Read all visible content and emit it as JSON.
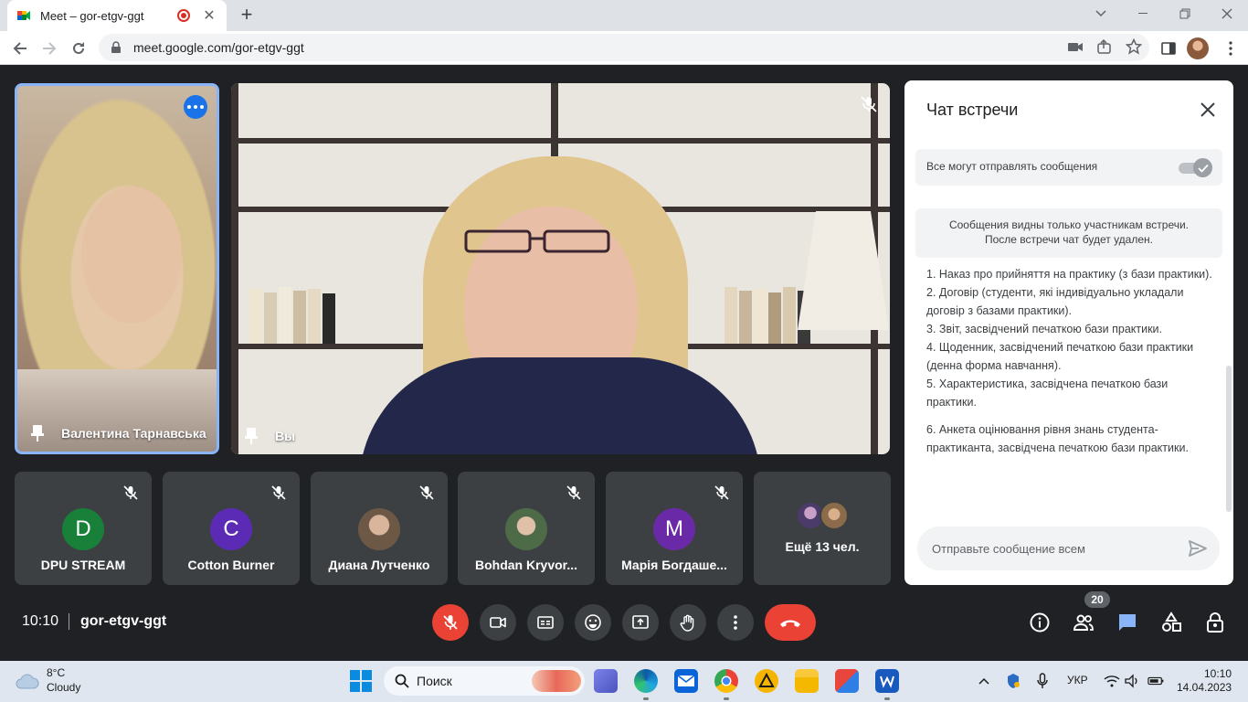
{
  "browser": {
    "tab_title": "Meet – gor-etgv-ggt",
    "url": "meet.google.com/gor-etgv-ggt"
  },
  "meeting": {
    "time": "10:10",
    "code": "gor-etgv-ggt",
    "participant_count": "20"
  },
  "tiles": {
    "speaker_name": "Валентина Тарнавська",
    "main_name": "Вы",
    "participants": [
      {
        "initial": "D",
        "name": "DPU STREAM",
        "color": "#188038"
      },
      {
        "initial": "C",
        "name": "Cotton Burner",
        "color": "#5b2bb5"
      },
      {
        "initial": "",
        "name": "Диана Лутченко",
        "color": ""
      },
      {
        "initial": "",
        "name": "Bohdan Kryvor...",
        "color": ""
      },
      {
        "initial": "M",
        "name": "Марія Богдаше...",
        "color": "#6a2aa8"
      }
    ],
    "more_label": "Ещё 13 чел."
  },
  "chat": {
    "title": "Чат встречи",
    "toggle_label": "Все могут отправлять сообщения",
    "info_line1": "Сообщения видны только участникам встречи.",
    "info_line2": "После встречи чат будет удален.",
    "messages": [
      "1.     Наказ про прийняття на практику (з бази практики).",
      "2.     Договір (студенти, які індивідуально укладали договір з базами практики).",
      "3.     Звіт, засвідчений печаткою бази практики.",
      "4.     Щоденник, засвідчений печаткою бази практики (денна форма навчання).",
      "5.     Характеристика, засвідчена печаткою бази практики.",
      "6.     Анкета оцінювання рівня знань студента-практиканта, засвідчена печаткою бази практики."
    ],
    "input_placeholder": "Отправьте сообщение всем"
  },
  "taskbar": {
    "temperature": "8°C",
    "weather": "Cloudy",
    "search_label": "Поиск",
    "language": "УКР",
    "time": "10:10",
    "date": "14.04.2023"
  },
  "colors": {
    "meet_bg": "#202124",
    "tile_bg": "#3c4043",
    "accent_blue": "#1a73e8",
    "active_border": "#8ab4f8",
    "danger_red": "#ea4335"
  }
}
